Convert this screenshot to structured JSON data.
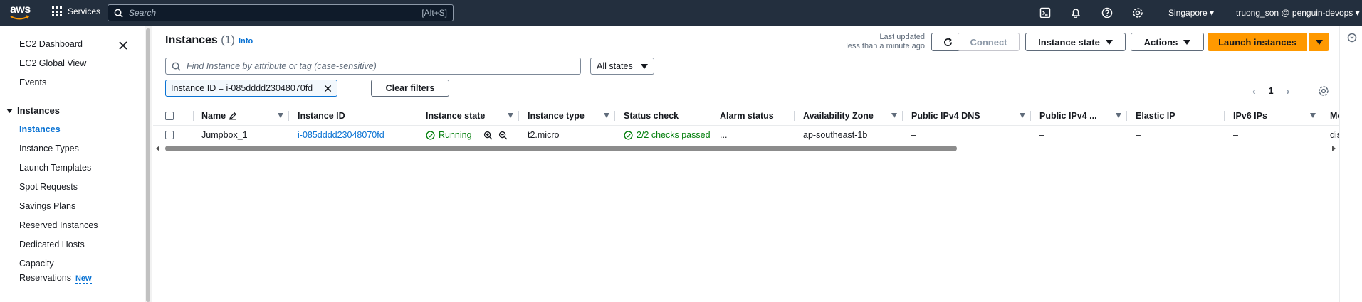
{
  "topnav": {
    "logo_text": "aws",
    "services_label": "Services",
    "search_placeholder": "Search",
    "search_shortcut": "[Alt+S]",
    "region": "Singapore ▾",
    "account": "truong_son @ penguin-devops ▾",
    "icons": [
      "cloudshell-icon",
      "bell-icon",
      "help-icon",
      "settings-icon"
    ]
  },
  "sidebar": {
    "items_top": [
      "EC2 Dashboard",
      "EC2 Global View",
      "Events"
    ],
    "section": "Instances",
    "items": [
      "Instances",
      "Instance Types",
      "Launch Templates",
      "Spot Requests",
      "Savings Plans",
      "Reserved Instances",
      "Dedicated Hosts"
    ],
    "capacity_line1": "Capacity",
    "capacity_line2": "Reservations",
    "new_badge": "New"
  },
  "header": {
    "title": "Instances",
    "count": "(1)",
    "info": "Info",
    "last_updated_line1": "Last updated",
    "last_updated_line2": "less than a minute ago",
    "connect": "Connect",
    "instance_state": "Instance state",
    "actions": "Actions",
    "launch": "Launch instances"
  },
  "filters": {
    "placeholder": "Find Instance by attribute or tag (case-sensitive)",
    "state_select": "All states",
    "token": "Instance ID = i-085dddd23048070fd",
    "clear": "Clear filters"
  },
  "pagination": {
    "page": "1",
    "prev": "‹",
    "next": "›"
  },
  "table": {
    "columns": [
      "Name",
      "Instance ID",
      "Instance state",
      "Instance type",
      "Status check",
      "Alarm status",
      "Availability Zone",
      "Public IPv4 DNS",
      "Public IPv4 ...",
      "Elastic IP",
      "IPv6 IPs",
      "Moni"
    ],
    "row": {
      "name": "Jumpbox_1",
      "instance_id": "i-085dddd23048070fd",
      "state": "Running",
      "type": "t2.micro",
      "status_check": "2/2 checks passed",
      "alarm": "...",
      "az": "ap-southeast-1b",
      "dns": "–",
      "ipv4": "–",
      "eip": "–",
      "ipv6": "–",
      "monitoring": "disab"
    }
  },
  "colors": {
    "nav_bg": "#232f3e",
    "link": "#0972d3",
    "primary": "#ff9900",
    "success": "#037f0c"
  }
}
